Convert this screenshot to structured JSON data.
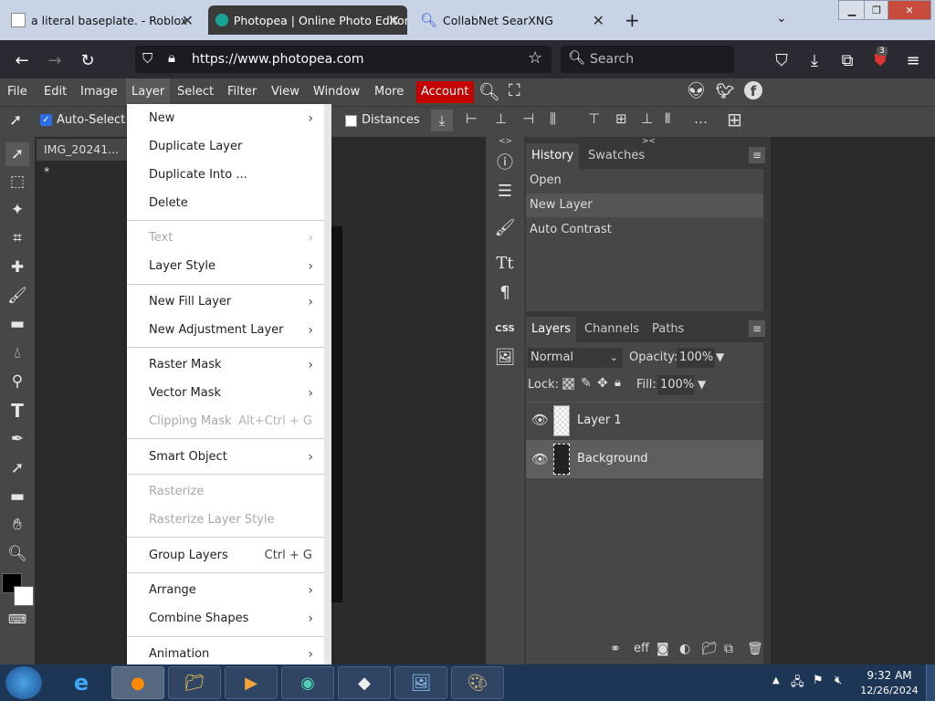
{
  "browser": {
    "tabs": [
      {
        "title": "a literal baseplate. - Roblox",
        "active": false
      },
      {
        "title": "Photopea | Online Photo Editor",
        "active": true
      },
      {
        "title": "CollabNet SearXNG",
        "active": false
      }
    ],
    "new_tab": "+",
    "url": "https://www.photopea.com",
    "search_placeholder": "Search",
    "ext_badge": "3"
  },
  "photopea": {
    "menu": [
      "File",
      "Edit",
      "Image",
      "Layer",
      "Select",
      "Filter",
      "View",
      "Window",
      "More",
      "Account"
    ],
    "options": {
      "auto_select": "Auto-Select",
      "distances": "Distances"
    },
    "doc_tab": "IMG_20241... *",
    "layer_menu": [
      {
        "label": "New",
        "sub": true
      },
      {
        "label": "Duplicate Layer"
      },
      {
        "label": "Duplicate Into ..."
      },
      {
        "label": "Delete"
      },
      {
        "label": "Text",
        "sub": true,
        "disabled": true
      },
      {
        "label": "Layer Style",
        "sub": true
      },
      {
        "label": "New Fill Layer",
        "sub": true
      },
      {
        "label": "New Adjustment Layer",
        "sub": true
      },
      {
        "label": "Raster Mask",
        "sub": true
      },
      {
        "label": "Vector Mask",
        "sub": true
      },
      {
        "label": "Clipping Mask",
        "shortcut": "Alt+Ctrl + G",
        "disabled": true
      },
      {
        "label": "Smart Object",
        "sub": true
      },
      {
        "label": "Rasterize",
        "disabled": true
      },
      {
        "label": "Rasterize Layer Style",
        "disabled": true
      },
      {
        "label": "Group Layers",
        "shortcut": "Ctrl + G"
      },
      {
        "label": "Arrange",
        "sub": true
      },
      {
        "label": "Combine Shapes",
        "sub": true
      },
      {
        "label": "Animation",
        "sub": true
      }
    ],
    "history": {
      "tabs": [
        "History",
        "Swatches"
      ],
      "items": [
        "Open",
        "New Layer",
        "Auto Contrast"
      ]
    },
    "layers": {
      "tabs": [
        "Layers",
        "Channels",
        "Paths"
      ],
      "blend_mode": "Normal",
      "opacity_label": "Opacity:",
      "opacity": "100%",
      "lock_label": "Lock:",
      "fill_label": "Fill:",
      "fill": "100%",
      "items": [
        "Layer 1",
        "Background"
      ]
    }
  },
  "taskbar": {
    "time": "9:32 AM",
    "date": "12/26/2024"
  },
  "colors": {
    "account_red": "#c50000",
    "menu_bg": "#474747",
    "panel_bg": "#383838",
    "taskbar": "#1e3656"
  }
}
